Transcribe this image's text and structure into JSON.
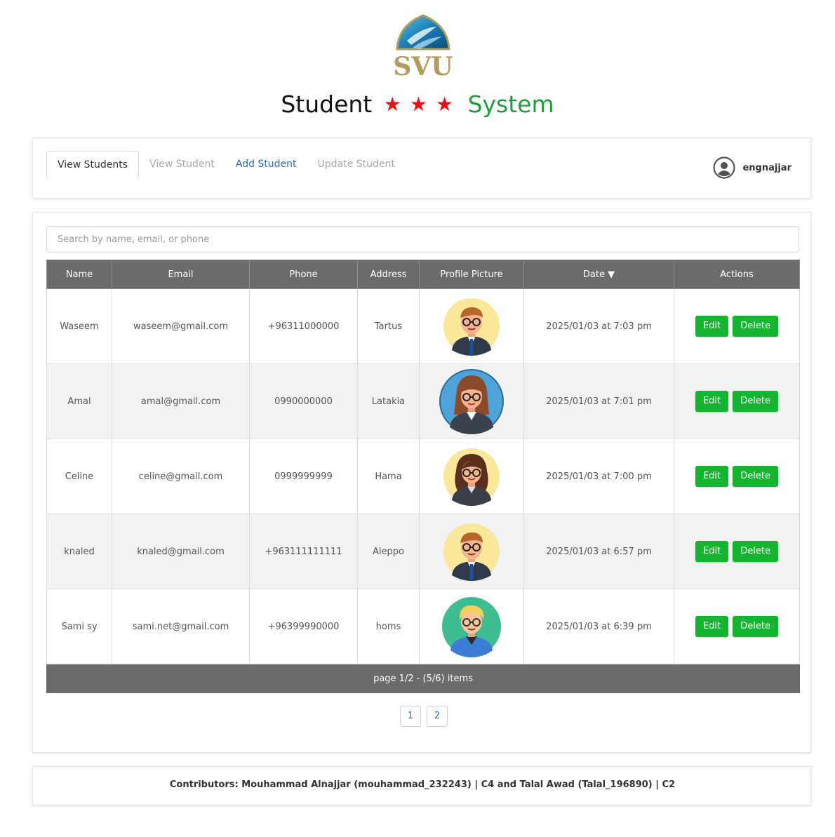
{
  "logo": {
    "text": "SVU"
  },
  "title": {
    "part1": "Student",
    "stars": [
      "★",
      "★",
      "★"
    ],
    "part2": "System"
  },
  "nav": {
    "tabs": [
      {
        "label": "View Students",
        "state": "active"
      },
      {
        "label": "View Student",
        "state": "disabled"
      },
      {
        "label": "Add Student",
        "state": "link"
      },
      {
        "label": "Update Student",
        "state": "disabled"
      }
    ],
    "user": {
      "icon": "user-circle-icon",
      "name": "engnajjar"
    }
  },
  "search": {
    "placeholder": "Search by name, email, or phone",
    "value": ""
  },
  "table": {
    "columns": [
      "Name",
      "Email",
      "Phone",
      "Address",
      "Profile Picture",
      "Date ▼",
      "Actions"
    ],
    "rows": [
      {
        "name": "Waseem",
        "email": "waseem@gmail.com",
        "phone": "+96311000000",
        "address": "Tartus",
        "avatar": "male-avatar-glasses",
        "date": "2025/01/03 at 7:03 pm"
      },
      {
        "name": "Amal",
        "email": "amal@gmail.com",
        "phone": "0990000000",
        "address": "Latakia",
        "avatar": "female-avatar-glasses",
        "date": "2025/01/03 at 7:01 pm"
      },
      {
        "name": "Celine",
        "email": "celine@gmail.com",
        "phone": "0999999999",
        "address": "Hama",
        "avatar": "female-avatar-curly",
        "date": "2025/01/03 at 7:00 pm"
      },
      {
        "name": "knaled",
        "email": "knaled@gmail.com",
        "phone": "+963111111111",
        "address": "Aleppo",
        "avatar": "male-avatar-glasses",
        "date": "2025/01/03 at 6:57 pm"
      },
      {
        "name": "Sami sy",
        "email": "sami.net@gmail.com",
        "phone": "+96399990000",
        "address": "homs",
        "avatar": "blond-avatar",
        "date": "2025/01/03 at 6:39 pm"
      }
    ],
    "actions": {
      "edit": "Edit",
      "delete": "Delete"
    },
    "footer": "page 1/2 - (5/6) items"
  },
  "pagination": [
    "1",
    "2"
  ],
  "footer": {
    "text": "Contributors: Mouhammad Alnajjar (mouhammad_232243) | C4 and Talal Awad (Talal_196890) | C2"
  },
  "colors": {
    "accent_green": "#16b531",
    "header_gray": "#6b6b6b",
    "link_blue": "#2d6db5",
    "star_red": "#e8121a",
    "system_green": "#1e9e3a"
  }
}
